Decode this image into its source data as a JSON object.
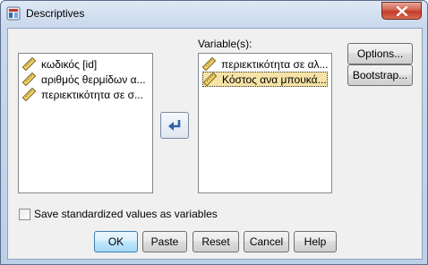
{
  "window": {
    "title": "Descriptives",
    "colors": {
      "close": "#c23c28",
      "selection": "#f7e3a6",
      "client": "#f0f0f0"
    },
    "icons": {
      "app": "spss-descriptives-icon",
      "close": "close-icon",
      "variable": "ruler-scale-icon",
      "move": "move-arrow-icon"
    }
  },
  "source_list": {
    "items": [
      {
        "label": "κωδικός [id]"
      },
      {
        "label": "αριθμός θερμίδων α..."
      },
      {
        "label": "περιεκτικότητα σε σ..."
      }
    ]
  },
  "variables": {
    "label": "Variable(s):",
    "items": [
      {
        "label": "περιεκτικότητα σε αλ...",
        "selected": false
      },
      {
        "label": "Κόστος ανα μπουκά...",
        "selected": true
      }
    ]
  },
  "side_buttons": {
    "options": "Options...",
    "bootstrap": "Bootstrap..."
  },
  "checkbox": {
    "label": "Save standardized values as variables",
    "checked": false
  },
  "buttons": {
    "ok": "OK",
    "paste": "Paste",
    "reset": "Reset",
    "cancel": "Cancel",
    "help": "Help"
  }
}
